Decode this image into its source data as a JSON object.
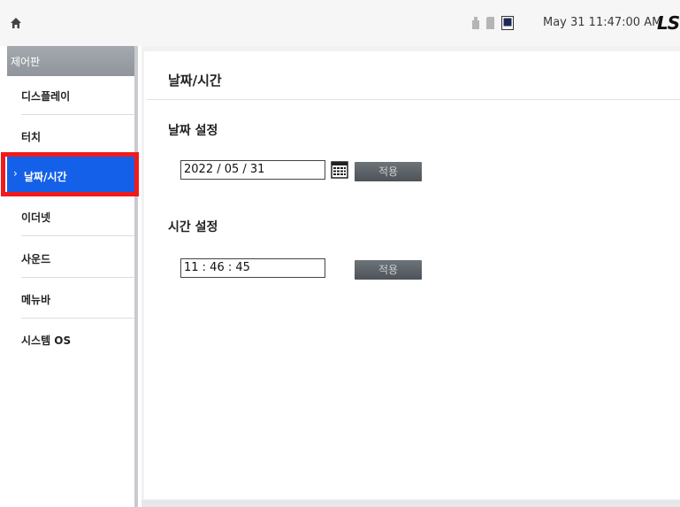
{
  "topbar": {
    "datetime": "May 31 11:47:00 AM",
    "logo": "LS"
  },
  "sidebar": {
    "header": "제어판",
    "items": [
      {
        "label": "디스플레이"
      },
      {
        "label": "터치"
      },
      {
        "label": "날짜/시간",
        "active": true
      },
      {
        "label": "이더넷"
      },
      {
        "label": "사운드"
      },
      {
        "label": "메뉴바"
      },
      {
        "label": "시스템 OS"
      }
    ]
  },
  "main": {
    "title": "날짜/시간",
    "date_section": {
      "title": "날짜 설정",
      "value": "2022 / 05 / 31",
      "apply_label": "적용"
    },
    "time_section": {
      "title": "시간 설정",
      "value": "11 : 46 : 45",
      "apply_label": "적용"
    }
  },
  "colors": {
    "active_item": "#1560e8",
    "highlight_box": "#f11a1a",
    "button": "#5a6065"
  }
}
